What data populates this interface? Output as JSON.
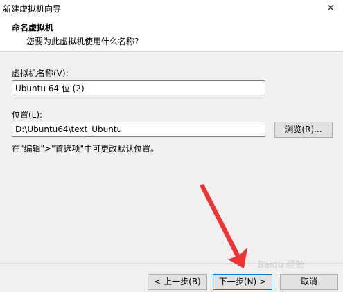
{
  "window": {
    "title": "新建虚拟机向导",
    "close_glyph": "✕"
  },
  "header": {
    "heading": "命名虚拟机",
    "subheading": "您要为此虚拟机使用什么名称?"
  },
  "form": {
    "name_label": "虚拟机名称(V):",
    "name_value": "Ubuntu 64 位 (2)",
    "location_label": "位置(L):",
    "location_value": "D:\\Ubuntu64\\text_Ubuntu",
    "browse_label": "浏览(R)...",
    "hint": "在\"编辑\">\"首选项\"中可更改默认位置。"
  },
  "footer": {
    "back_label": "< 上一步(B)",
    "next_label": "下一步(N) >",
    "cancel_label": "取消"
  },
  "annotation": {
    "arrow_color": "#ee3333",
    "watermark_text": "Baidu 经验"
  }
}
